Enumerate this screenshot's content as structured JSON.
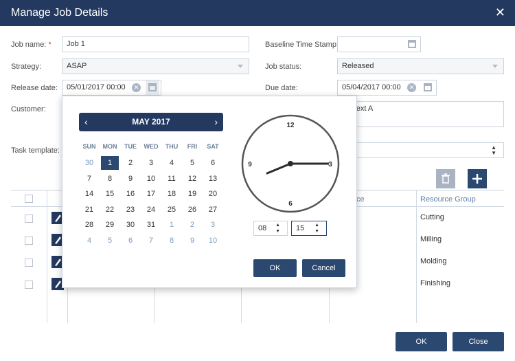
{
  "dialog": {
    "title": "Manage Job Details"
  },
  "form": {
    "job_name_label": "Job name:",
    "required_mark": "*",
    "job_name_value": "Job 1",
    "strategy_label": "Strategy:",
    "strategy_value": "ASAP",
    "release_date_label": "Release date:",
    "release_date_value": "05/01/2017 00:00",
    "customer_label": "Customer:",
    "task_template_label": "Task template:",
    "baseline_label": "Baseline Time Stamp:",
    "job_status_label": "Job status:",
    "job_status_value": "Released",
    "due_date_label": "Due date:",
    "due_date_value": "05/04/2017 00:00",
    "description_value": "my text A"
  },
  "table": {
    "partial_header": "ce",
    "resource_group_header": "Resource Group",
    "rows": [
      "Cutting",
      "Milling",
      "Molding",
      "Finishing"
    ]
  },
  "picker": {
    "month_label": "MAY 2017",
    "weekdays": [
      "SUN",
      "MON",
      "TUE",
      "WED",
      "THU",
      "FRI",
      "SAT"
    ],
    "days": [
      [
        "30",
        "1",
        "2",
        "3",
        "4",
        "5",
        "6"
      ],
      [
        "7",
        "8",
        "9",
        "10",
        "11",
        "12",
        "13"
      ],
      [
        "14",
        "15",
        "16",
        "17",
        "18",
        "19",
        "20"
      ],
      [
        "21",
        "22",
        "23",
        "24",
        "25",
        "26",
        "27"
      ],
      [
        "28",
        "29",
        "30",
        "31",
        "1",
        "2",
        "3"
      ],
      [
        "4",
        "5",
        "6",
        "7",
        "8",
        "9",
        "10"
      ]
    ],
    "selected_day": "1",
    "clock": {
      "n12": "12",
      "n3": "3",
      "n6": "6",
      "n9": "9",
      "hour": 8,
      "minute": 15
    },
    "hour_value": "08",
    "minute_value": "15",
    "ok_label": "OK",
    "cancel_label": "Cancel"
  },
  "footer": {
    "ok_label": "OK",
    "close_label": "Close"
  },
  "colors": {
    "header": "#23395f",
    "accent": "#2b4870",
    "other_month": "#7d9cc2"
  }
}
